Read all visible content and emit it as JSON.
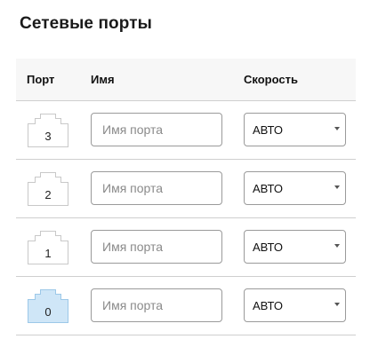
{
  "page": {
    "title": "Сетевые порты"
  },
  "table": {
    "headers": {
      "port": "Порт",
      "name": "Имя",
      "speed": "Скорость"
    },
    "rows": [
      {
        "port": "3",
        "name_value": "",
        "name_placeholder": "Имя порта",
        "speed": "АВТО",
        "active": false
      },
      {
        "port": "2",
        "name_value": "",
        "name_placeholder": "Имя порта",
        "speed": "АВТО",
        "active": false
      },
      {
        "port": "1",
        "name_value": "",
        "name_placeholder": "Имя порта",
        "speed": "АВТО",
        "active": false
      },
      {
        "port": "0",
        "name_value": "",
        "name_placeholder": "Имя порта",
        "speed": "АВТО",
        "active": true
      }
    ]
  },
  "colors": {
    "port_inactive_fill": "#ffffff",
    "port_inactive_stroke": "#c8c8c8",
    "port_active_fill": "#cfe6f7",
    "port_active_stroke": "#9cc8e8"
  },
  "icons": {
    "port": "ethernet-port-icon",
    "dropdown": "chevron-down-icon"
  }
}
